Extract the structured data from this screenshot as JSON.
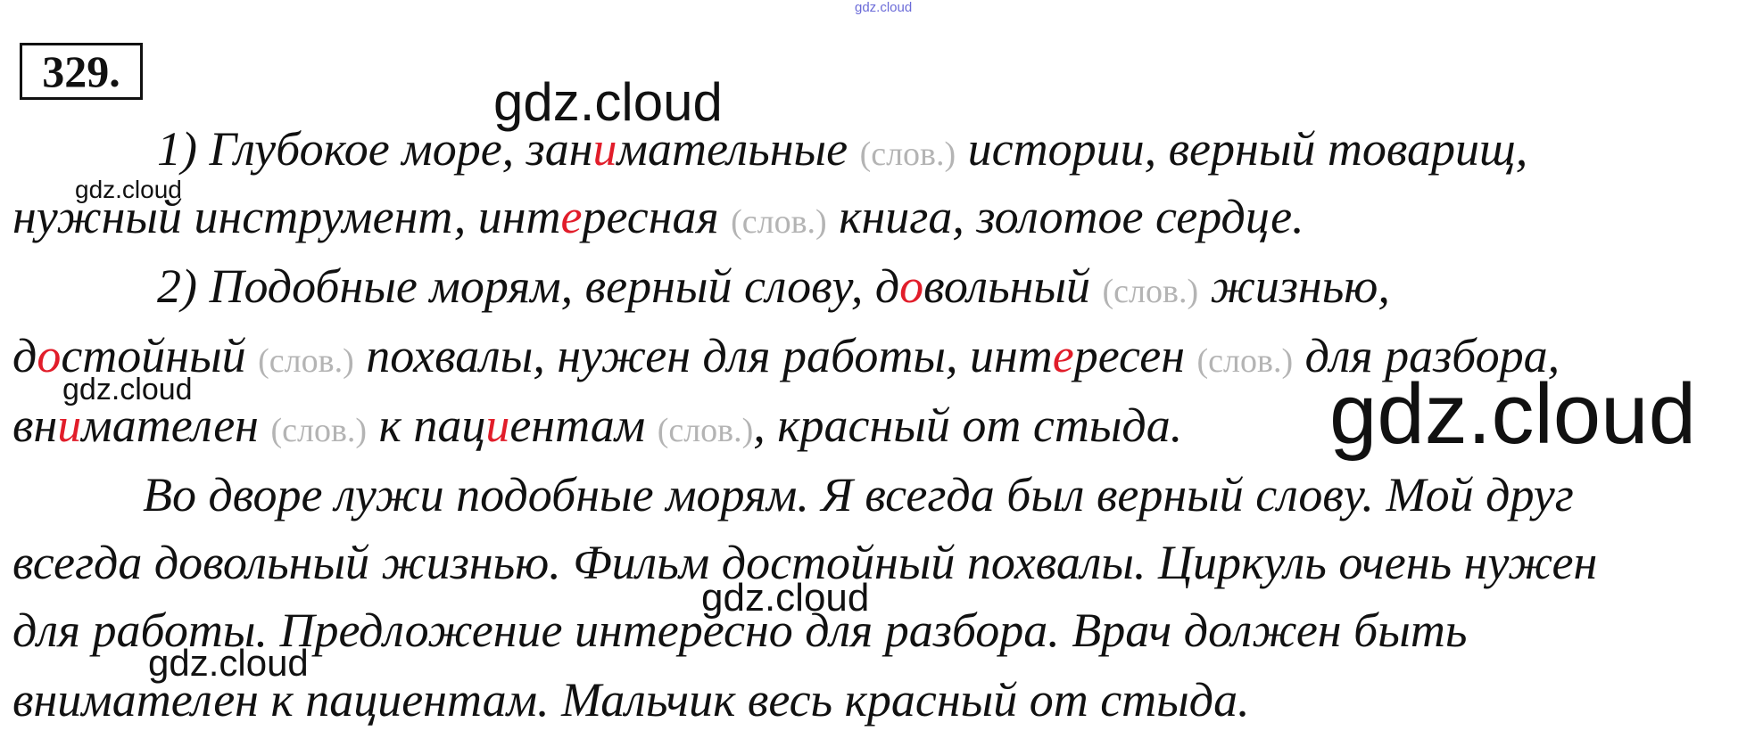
{
  "exercise_number": "329.",
  "watermarks": {
    "top": "gdz.cloud",
    "w1": "gdz.cloud",
    "w2": "gdz.cloud",
    "w3": "gdz.cloud",
    "w4": "gdz.cloud",
    "w5": "gdz.cloud",
    "w6": "gdz.cloud"
  },
  "lines": {
    "l1": {
      "a": "1) Глубокое море, зан",
      "hi": "и",
      "b": "мательные",
      "note": "(слов.)",
      "c": "истории, верный товарищ,"
    },
    "l2": {
      "a": "нужный инструмент, инт",
      "hi": "е",
      "b": "ресная",
      "note": "(слов.)",
      "c": "книга, золотое сердце."
    },
    "l3": {
      "a": "2)  Подобные морям, верный слову, д",
      "hi": "о",
      "b": "вольный",
      "note": "(слов.)",
      "c": "жизнью,"
    },
    "l4": {
      "a": "д",
      "hi": "о",
      "b": "стойный",
      "note": "(слов.)",
      "c": "похвалы, нужен для работы, инт",
      "hi2": "е",
      "d": "ресен",
      "note2": "(слов.)",
      "e": "для разбора,"
    },
    "l5": {
      "a": "вн",
      "hi": "и",
      "b": "мателен",
      "note": "(слов.)",
      "c": "к пац",
      "hi2": "и",
      "d": "ентам",
      "note2": "(слов.)",
      "e": ", красный от стыда."
    },
    "l6": "Во дворе лужи подобные морям. Я всегда был верный слову. Мой друг",
    "l7": "всегда довольный жизнью. Фильм достойный похвалы. Циркуль очень нужен",
    "l8": "для работы. Предложение интересно для разбора. Врач должен быть",
    "l9": "внимателен к пациентам. Мальчик весь красный от стыда."
  },
  "colors": {
    "highlight": "#e11d2a",
    "note": "#b4b4b4",
    "top_watermark": "#6b6bd8"
  }
}
